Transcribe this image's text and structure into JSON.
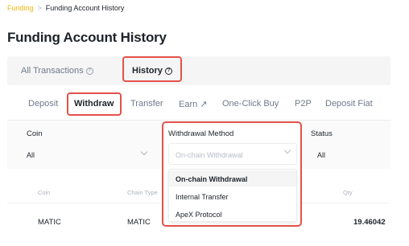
{
  "breadcrumb": {
    "parent": "Funding",
    "separator": ">",
    "current": "Funding Account History"
  },
  "page_title": "Funding Account History",
  "main_tabs": [
    {
      "label": "All Transactions",
      "icon": "question-circle-icon",
      "active": false
    },
    {
      "label": "History",
      "icon": "question-circle-icon",
      "active": true
    }
  ],
  "sub_tabs": [
    {
      "label": "Deposit",
      "active": false
    },
    {
      "label": "Withdraw",
      "active": true
    },
    {
      "label": "Transfer",
      "active": false
    },
    {
      "label": "Earn ↗",
      "active": false
    },
    {
      "label": "One-Click Buy",
      "active": false
    },
    {
      "label": "P2P",
      "active": false
    },
    {
      "label": "Deposit Fiat",
      "active": false
    }
  ],
  "filters": {
    "coin": {
      "label": "Coin",
      "value": "All"
    },
    "withdrawal_method": {
      "label": "Withdrawal Method",
      "placeholder": "On-chain Withdrawal",
      "options": [
        "On-chain Withdrawal",
        "Internal Transfer",
        "ApeX Protocol"
      ],
      "selected": "On-chain Withdrawal"
    },
    "status": {
      "label": "Status",
      "value": "All"
    }
  },
  "table": {
    "headers": [
      "Coin",
      "Chain Type",
      "Qty"
    ],
    "rows": [
      {
        "coin": "MATIC",
        "chain_type": "MATIC",
        "qty": "19.46042"
      }
    ]
  },
  "colors": {
    "brand": "#f0b90b",
    "highlight": "#e4514a",
    "text": "#1e2329",
    "muted": "#707a8a"
  }
}
